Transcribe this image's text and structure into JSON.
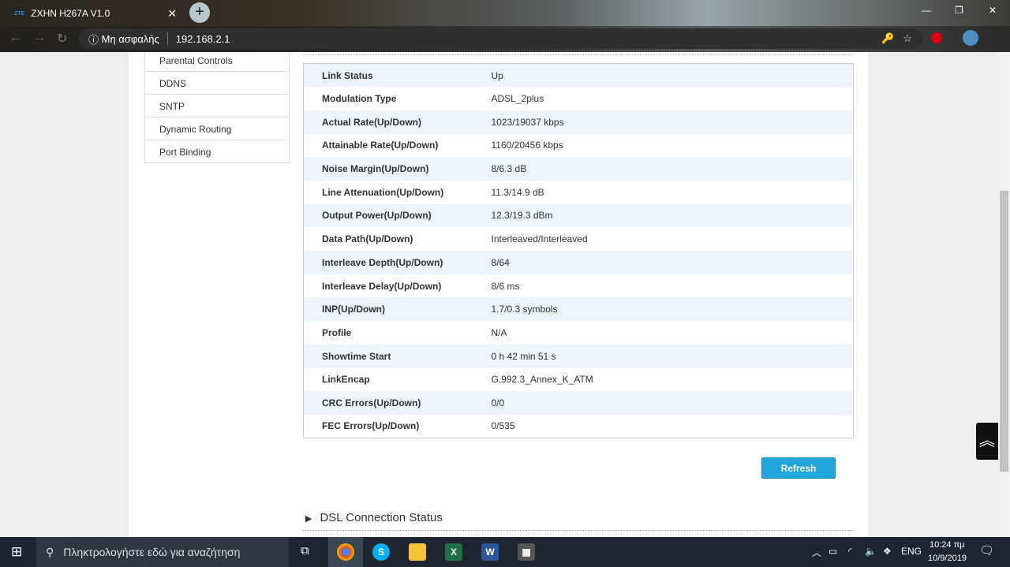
{
  "browser": {
    "tab_logo": "ZTE",
    "tab_title": "ZXHN H267A V1.0",
    "security_label": "Μη ασφαλής",
    "url": "192.168.2.1"
  },
  "sidebar": {
    "items": [
      "Parental Controls",
      "DDNS",
      "SNTP",
      "Dynamic Routing",
      "Port Binding"
    ]
  },
  "dsl_table": [
    {
      "label": "Link Status",
      "value": "Up"
    },
    {
      "label": "Modulation Type",
      "value": "ADSL_2plus"
    },
    {
      "label": "Actual Rate(Up/Down)",
      "value": "1023/19037 kbps"
    },
    {
      "label": "Attainable Rate(Up/Down)",
      "value": "1160/20456 kbps"
    },
    {
      "label": "Noise Margin(Up/Down)",
      "value": "8/6.3 dB"
    },
    {
      "label": "Line Attenuation(Up/Down)",
      "value": "11.3/14.9 dB"
    },
    {
      "label": "Output Power(Up/Down)",
      "value": "12.3/19.3 dBm"
    },
    {
      "label": "Data Path(Up/Down)",
      "value": "Interleaved/Interleaved"
    },
    {
      "label": "Interleave Depth(Up/Down)",
      "value": "8/64"
    },
    {
      "label": "Interleave Delay(Up/Down)",
      "value": "8/6 ms"
    },
    {
      "label": "INP(Up/Down)",
      "value": "1.7/0.3 symbols"
    },
    {
      "label": "Profile",
      "value": "N/A"
    },
    {
      "label": "Showtime Start",
      "value": "0 h 42 min 51 s"
    },
    {
      "label": "LinkEncap",
      "value": "G.992.3_Annex_K_ATM"
    },
    {
      "label": "CRC Errors(Up/Down)",
      "value": "0/0"
    },
    {
      "label": "FEC Errors(Up/Down)",
      "value": "0/535"
    }
  ],
  "refresh_label": "Refresh",
  "section_title": "DSL Connection Status",
  "taskbar": {
    "search_placeholder": "Πληκτρολογήστε εδώ για αναζήτηση",
    "lang": "ENG",
    "time": "10:24 πμ",
    "date": "10/9/2019"
  }
}
